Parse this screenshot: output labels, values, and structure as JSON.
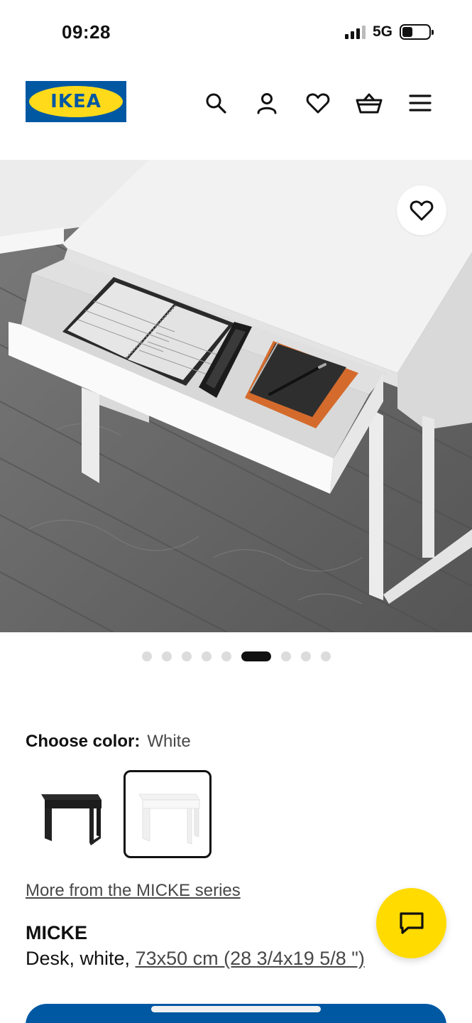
{
  "status_bar": {
    "time": "09:28",
    "network": "5G"
  },
  "header": {
    "logo_text": "IKEA",
    "icons": [
      "search-icon",
      "user-icon",
      "heart-icon",
      "basket-icon",
      "menu-icon"
    ]
  },
  "gallery": {
    "image_count": 9,
    "active_index": 5
  },
  "color": {
    "label": "Choose color:",
    "selected": "White",
    "options": [
      "black-brown",
      "white"
    ]
  },
  "series_link": "More from the MICKE series",
  "product": {
    "name": "MICKE",
    "desc_prefix": "Desk, white, ",
    "dimensions": "73x50 cm (28 3/4x19 5/8 \")"
  },
  "colors": {
    "ikea_blue": "#0058a3",
    "ikea_yellow": "#ffda1a",
    "chat_yellow": "#ffdb00"
  }
}
